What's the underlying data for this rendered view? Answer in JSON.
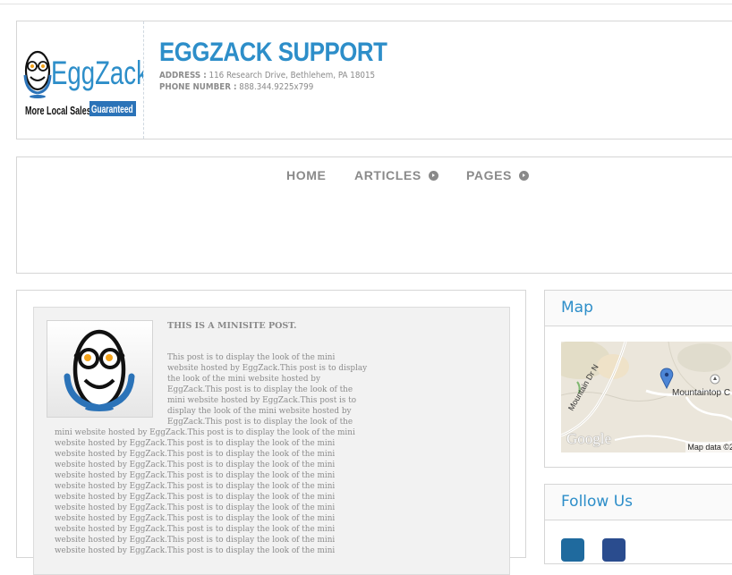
{
  "header": {
    "logo": {
      "name": "EggZack",
      "tagline": "More Local Sales",
      "badge": "Guaranteed"
    },
    "title": "EGGZACK SUPPORT",
    "address_label": "ADDRESS :",
    "address": "116 Research Drive, Bethlehem, PA 18015",
    "phone_label": "PHONE NUMBER :",
    "phone": "888.344.9225x799"
  },
  "nav": {
    "items": [
      {
        "label": "HOME",
        "dropdown": false
      },
      {
        "label": "ARTICLES",
        "dropdown": true
      },
      {
        "label": "PAGES",
        "dropdown": true
      }
    ]
  },
  "post": {
    "title": "THIS IS A MINISITE POST.",
    "lines": [
      "This post is to display the look of the mini",
      "website hosted by EggZack.This post is to display",
      "the look of the mini website hosted by",
      "EggZack.This post is to display the look of the",
      "mini website hosted by EggZack.This post is to",
      "display the look of the mini website hosted by",
      "EggZack.This post is to display the look of the",
      "mini website hosted by EggZack.This post is to display the look of the mini",
      "website hosted by EggZack.This post is to display the look of the mini",
      "website hosted by EggZack.This post is to display the look of the mini",
      "website hosted by EggZack.This post is to display the look of the mini",
      "website hosted by EggZack.This post is to display the look of the mini",
      "website hosted by EggZack.This post is to display the look of the mini",
      "website hosted by EggZack.This post is to display the look of the mini",
      "website hosted by EggZack.This post is to display the look of the mini",
      "website hosted by EggZack.This post is to display the look of the mini",
      "website hosted by EggZack.This post is to display the look of the mini",
      "website hosted by EggZack.This post is to display the look of the mini",
      "website hosted by EggZack.This post is to display the look of the mini"
    ]
  },
  "sidebar": {
    "map": {
      "title": "Map",
      "place_label": "Mountaintop C",
      "road_1": "Mountain Dr N",
      "provider": "Google",
      "attribution": "Map data ©20"
    },
    "follow": {
      "title": "Follow Us",
      "icons": [
        "linkedin-icon",
        "facebook-icon"
      ]
    }
  },
  "colors": {
    "accent": "#2d8ec9",
    "nav_text": "#8a8a8a",
    "border": "#d6d6d6"
  }
}
